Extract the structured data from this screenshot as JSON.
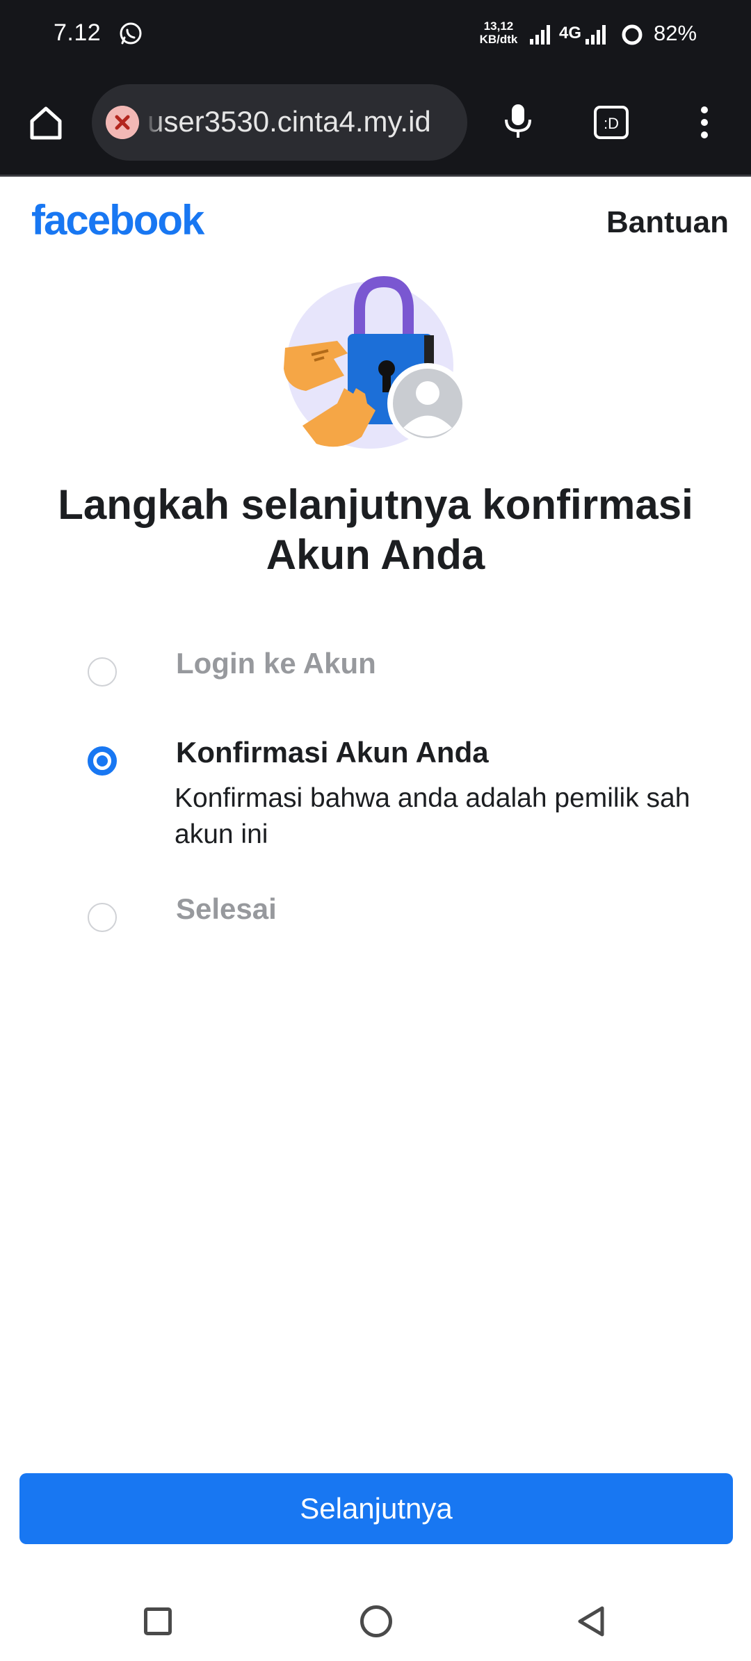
{
  "status_bar": {
    "time": "7.12",
    "net_speed_value": "13,12",
    "net_speed_unit": "KB/dtk",
    "network_type": "4G",
    "battery": "82%"
  },
  "browser": {
    "url": "user3530.cinta4.my.id",
    "tab_label": ":D"
  },
  "page": {
    "logo": "facebook",
    "help_link": "Bantuan",
    "title": "Langkah selanjutnya konfirmasi Akun Anda",
    "steps": [
      {
        "label": "Login ke Akun",
        "state": "inactive"
      },
      {
        "label": "Konfirmasi Akun Anda",
        "state": "active",
        "description": "Konfirmasi bahwa anda adalah pemilik sah akun ini"
      },
      {
        "label": "Selesai",
        "state": "inactive"
      }
    ],
    "next_button": "Selanjutnya"
  },
  "colors": {
    "brand": "#1877f2",
    "chrome_bg": "#15161a",
    "url_pill_bg": "#2b2c31",
    "text": "#1c1e21",
    "muted_text": "#97999d"
  },
  "icons": {
    "status": [
      "whatsapp-icon",
      "signal-icon",
      "battery-ring-icon"
    ],
    "browser": [
      "home-icon",
      "site-warning-icon",
      "mic-icon",
      "tab-switcher-icon",
      "overflow-menu-icon"
    ],
    "nav": [
      "recent-apps-icon",
      "home-nav-icon",
      "back-icon"
    ]
  }
}
